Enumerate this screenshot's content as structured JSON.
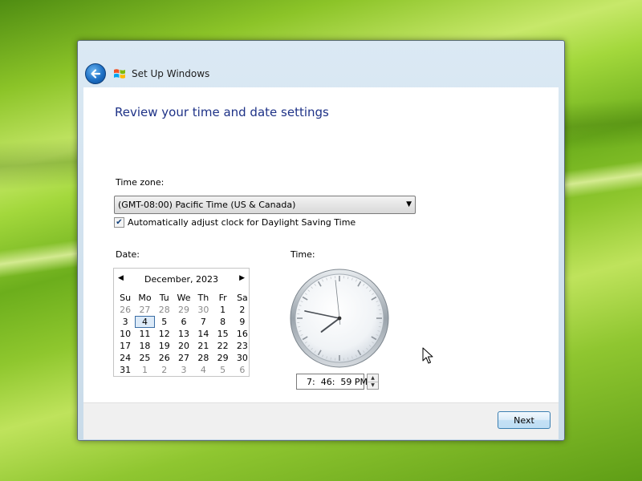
{
  "window": {
    "title": "Set Up Windows"
  },
  "page": {
    "heading": "Review your time and date settings",
    "timezone_label": "Time zone:",
    "timezone_value": "(GMT-08:00) Pacific Time (US & Canada)",
    "dst_label": "Automatically adjust clock for Daylight Saving Time",
    "dst_checked": true,
    "date_label": "Date:",
    "time_label": "Time:"
  },
  "calendar": {
    "month_title": "December, 2023",
    "days_of_week": [
      "Su",
      "Mo",
      "Tu",
      "We",
      "Th",
      "Fr",
      "Sa"
    ],
    "weeks": [
      [
        "26",
        "27",
        "28",
        "29",
        "30",
        "1",
        "2"
      ],
      [
        "3",
        "4",
        "5",
        "6",
        "7",
        "8",
        "9"
      ],
      [
        "10",
        "11",
        "12",
        "13",
        "14",
        "15",
        "16"
      ],
      [
        "17",
        "18",
        "19",
        "20",
        "21",
        "22",
        "23"
      ],
      [
        "24",
        "25",
        "26",
        "27",
        "28",
        "29",
        "30"
      ],
      [
        "31",
        "1",
        "2",
        "3",
        "4",
        "5",
        "6"
      ]
    ],
    "selected_day": "4"
  },
  "clock": {
    "time_text": "7:  46:  59 PM",
    "hour": 7,
    "minute": 46,
    "second": 59
  },
  "footer": {
    "next_label": "Next"
  },
  "colors": {
    "heading": "#1e3287",
    "accent": "#1d6fc4"
  }
}
